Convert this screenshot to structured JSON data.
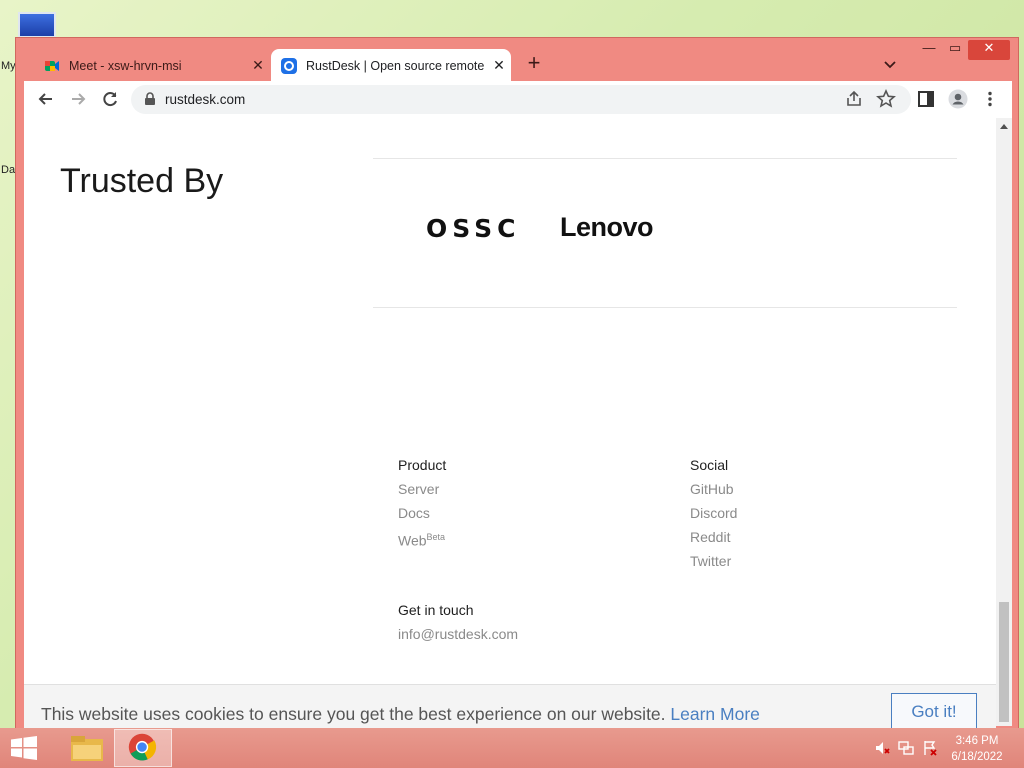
{
  "desktop": {
    "labels": [
      "My",
      "Da"
    ]
  },
  "browser": {
    "tabs": [
      {
        "title": "Meet - xsw-hrvn-msi",
        "active": false,
        "favicon": "google-meet-icon"
      },
      {
        "title": "RustDesk | Open source remote d",
        "active": true,
        "favicon": "rustdesk-icon"
      }
    ],
    "new_tab": "+",
    "address": "rustdesk.com"
  },
  "page": {
    "trusted_heading": "Trusted By",
    "logos": [
      "OSSC",
      "Lenovo"
    ],
    "footer": {
      "product": {
        "heading": "Product",
        "links": [
          "Server",
          "Docs",
          "Web"
        ],
        "web_sup": "Beta"
      },
      "social": {
        "heading": "Social",
        "links": [
          "GitHub",
          "Discord",
          "Reddit",
          "Twitter"
        ]
      },
      "contact": {
        "heading": "Get in touch",
        "email": "info@rustdesk.com"
      }
    },
    "cookie": {
      "message": "This website uses cookies to ensure you get the best experience on our website.",
      "learn_more": "Learn More",
      "button": "Got it!"
    }
  },
  "taskbar": {
    "time": "3:46 PM",
    "date": "6/18/2022"
  },
  "colors": {
    "window_frame": "#f08a82",
    "taskbar": "#e0857a",
    "link_blue": "#4a7fc1"
  }
}
